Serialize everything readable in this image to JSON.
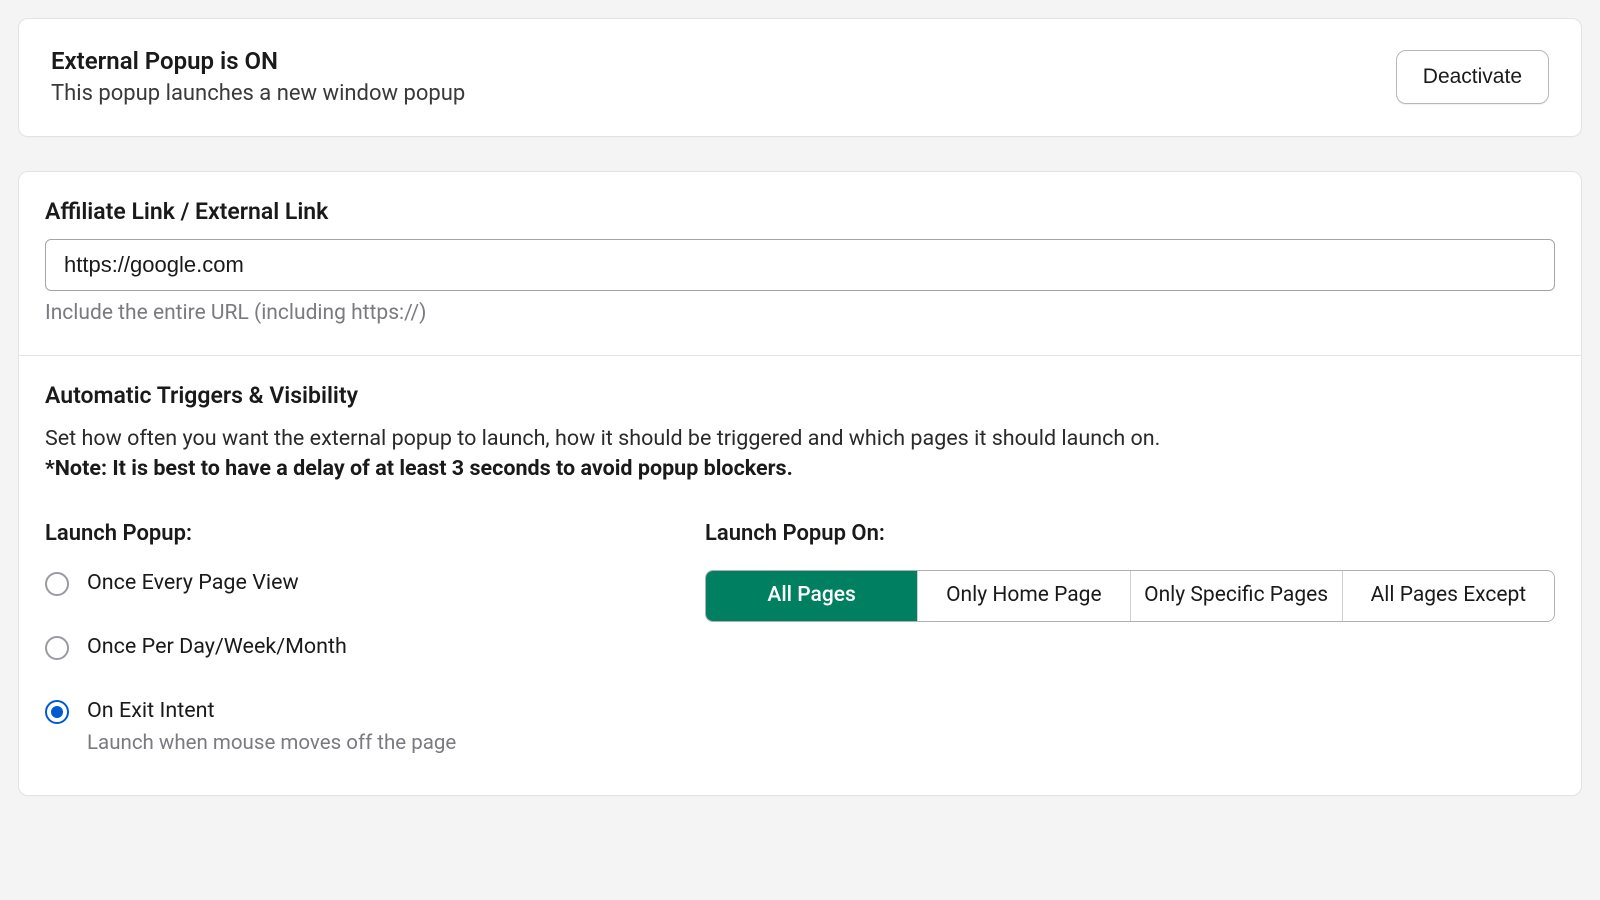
{
  "status": {
    "title": "External Popup is ON",
    "subtitle": "This popup launches a new window popup",
    "deactivate_label": "Deactivate"
  },
  "link": {
    "heading": "Affiliate Link / External Link",
    "value": "https://google.com",
    "help": "Include the entire URL (including https://)"
  },
  "triggers": {
    "heading": "Automatic Triggers & Visibility",
    "description": "Set how often you want the external popup to launch, how it should be triggered and which pages it should launch on.",
    "note": "*Note: It is best to have a delay of at least 3 seconds to avoid popup blockers.",
    "launch_label": "Launch Popup:",
    "launch_on_label": "Launch Popup On:",
    "radios": [
      {
        "label": "Once Every Page View",
        "hint": "",
        "selected": false
      },
      {
        "label": "Once Per Day/Week/Month",
        "hint": "",
        "selected": false
      },
      {
        "label": "On Exit Intent",
        "hint": "Launch when mouse moves off the page",
        "selected": true
      }
    ],
    "segments": [
      {
        "label": "All Pages",
        "active": true
      },
      {
        "label": "Only Home Page",
        "active": false
      },
      {
        "label": "Only Specific Pages",
        "active": false
      },
      {
        "label": "All Pages Except",
        "active": false
      }
    ]
  }
}
